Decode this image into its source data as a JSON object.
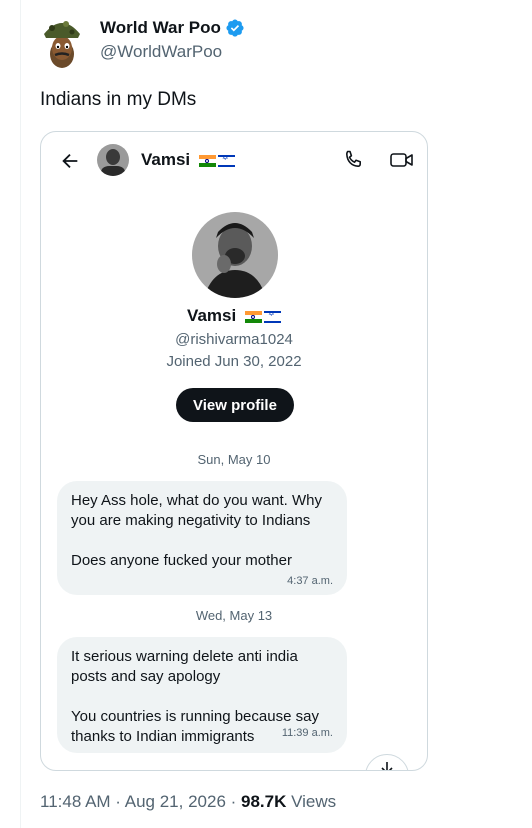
{
  "tweet": {
    "author_name": "World War Poo",
    "author_handle": "@WorldWarPoo",
    "text": "Indians in my DMs",
    "time": "11:48 AM",
    "separator": " · ",
    "date": "Aug 21, 2026",
    "views_count": "98.7K",
    "views_label": "Views"
  },
  "dm": {
    "header_name": "Vamsi",
    "profile": {
      "name": "Vamsi",
      "handle": "@rishivarma1024",
      "joined": "Joined Jun 30, 2022",
      "view_profile_label": "View profile"
    },
    "groups": [
      {
        "date": "Sun, May 10",
        "message": {
          "line1": "Hey Ass hole, what do you want. Why",
          "line2": "you are making negativity to Indians",
          "line3": "Does anyone fucked your mother",
          "time": "4:37 a.m."
        }
      },
      {
        "date": "Wed, May 13",
        "message": {
          "line1": "It serious warning delete anti india",
          "line2": "posts and say apology",
          "line3": "You countries is running because say",
          "line4": "thanks to Indian immigrants",
          "time": "11:39 a.m."
        }
      }
    ]
  },
  "icons": {
    "verified": "verified-badge-icon",
    "back": "arrow-left-icon",
    "phone": "phone-icon",
    "video": "video-camera-icon",
    "scroll": "arrow-down-icon",
    "flags": [
      "india-flag-icon",
      "israel-flag-icon"
    ]
  },
  "colors": {
    "verified_blue": "#1d9bf0",
    "text_primary": "#0f1419",
    "text_secondary": "#536471",
    "bubble_bg": "#eff3f4",
    "button_bg": "#0f1419"
  }
}
